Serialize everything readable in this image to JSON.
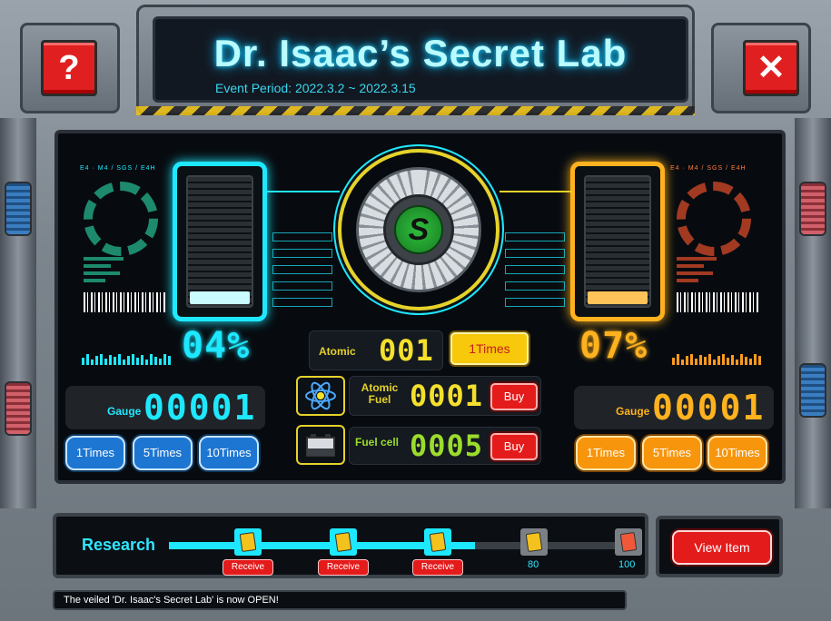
{
  "header": {
    "title": "Dr. Isaac’s Secret Lab",
    "event_period": "Event Period: 2022.3.2 ~ 2022.3.15",
    "help_label": "?",
    "close_label": "✕"
  },
  "colors": {
    "cyan": "#1ee8ff",
    "orange": "#ffb21e",
    "yellow": "#e6d22a",
    "green": "#9cdc2c",
    "red_button": "#e41b1b"
  },
  "left": {
    "hud_code": "E4 · M4 / SGS / E4H",
    "percent": "04%",
    "fill_level": 0.1,
    "gauge_label": "Gauge",
    "gauge_value": "00001",
    "buttons": [
      "1Times",
      "5Times",
      "10Times"
    ]
  },
  "right": {
    "hud_code": "E4 · M4 / SGS / E4H",
    "percent": "07%",
    "fill_level": 0.1,
    "gauge_label": "Gauge",
    "gauge_value": "00001",
    "buttons": [
      "1Times",
      "5Times",
      "10Times"
    ]
  },
  "center": {
    "reactor_symbol": "S",
    "atomic": {
      "label": "Atomic",
      "value": "001",
      "button": "1Times"
    },
    "atomic_fuel": {
      "label_line1": "Atomic",
      "label_line2": "Fuel",
      "value": "0001",
      "button": "Buy",
      "icon": "atom-icon"
    },
    "fuel_cell": {
      "label": "Fuel cell",
      "value": "0005",
      "button": "Buy",
      "icon": "battery-icon"
    }
  },
  "research": {
    "title": "Research",
    "progress": 0.68,
    "rewards": [
      {
        "state": "received",
        "button": "Receive"
      },
      {
        "state": "received",
        "button": "Receive"
      },
      {
        "state": "received",
        "button": "Receive"
      },
      {
        "state": "locked",
        "milestone": "80"
      },
      {
        "state": "locked",
        "milestone": "100"
      }
    ]
  },
  "view_item_label": "View Item",
  "ticker": "The veiled 'Dr. Isaac's Secret Lab' is now OPEN!"
}
